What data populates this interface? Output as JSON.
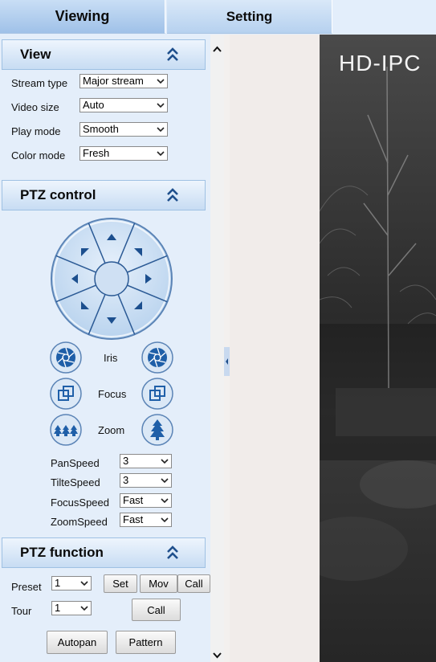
{
  "tabs": {
    "viewing": "Viewing",
    "setting": "Setting"
  },
  "view": {
    "title": "View",
    "rows": [
      {
        "label": "Stream type",
        "value": "Major stream"
      },
      {
        "label": "Video size",
        "value": "Auto"
      },
      {
        "label": "Play mode",
        "value": "Smooth"
      },
      {
        "label": "Color mode",
        "value": "Fresh"
      }
    ]
  },
  "ptz": {
    "title": "PTZ control",
    "iris": "Iris",
    "focus": "Focus",
    "zoom": "Zoom",
    "speeds": [
      {
        "label": "PanSpeed",
        "value": "3"
      },
      {
        "label": "TilteSpeed",
        "value": "3"
      },
      {
        "label": "FocusSpeed",
        "value": "Fast"
      },
      {
        "label": "ZoomSpeed",
        "value": "Fast"
      }
    ]
  },
  "ptz_function": {
    "title": "PTZ function",
    "preset_label": "Preset",
    "preset_value": "1",
    "set": "Set",
    "mov": "Mov",
    "call": "Call",
    "tour_label": "Tour",
    "tour_value": "1",
    "tour_call": "Call",
    "autopan": "Autopan",
    "pattern": "Pattern"
  },
  "video": {
    "title": "HD-IPC"
  },
  "colors": {
    "accent": "#1f5fa8",
    "panel": "#e4eefa"
  }
}
